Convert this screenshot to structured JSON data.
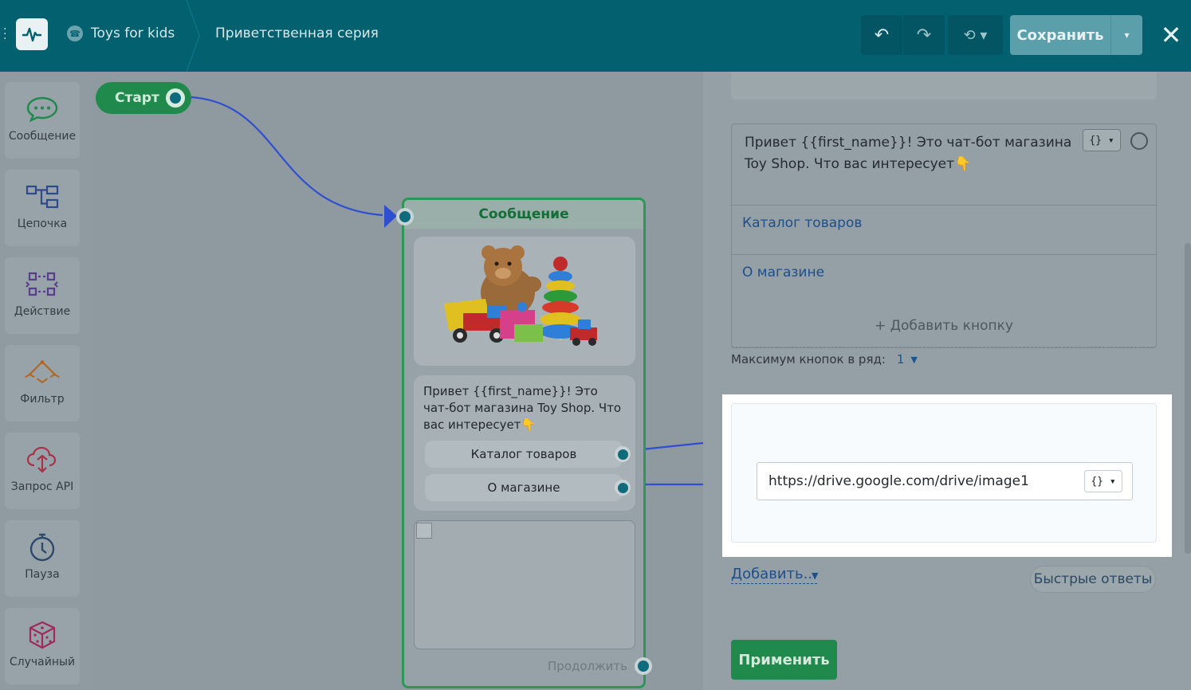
{
  "header": {
    "menu_icon": "⋮",
    "project_name": "Toys for kids",
    "flow_name": "Приветственная серия",
    "undo_icon": "↶",
    "redo_icon": "↷",
    "history_icon": "⟲ ▾",
    "save_label": "Сохранить",
    "save_caret": "▾",
    "close_icon": "✕"
  },
  "tools": [
    {
      "label": "Сообщение",
      "icon": "chat-bubble-icon"
    },
    {
      "label": "Цепочка",
      "icon": "chain-icon"
    },
    {
      "label": "Действие",
      "icon": "action-icon"
    },
    {
      "label": "Фильтр",
      "icon": "filter-icon"
    },
    {
      "label": "Запрос API",
      "icon": "cloud-api-icon"
    },
    {
      "label": "Пауза",
      "icon": "stopwatch-icon"
    },
    {
      "label": "Случайный",
      "icon": "dice-icon"
    }
  ],
  "canvas": {
    "start_label": "Старт",
    "message_node": {
      "title": "Сообщение",
      "text": "Привет {{first_name}}! Это чат-бот магазина Toy Shop. Что вас интересует👇",
      "buttons": [
        "Каталог товаров",
        "О магазине"
      ],
      "continue_label": "Продолжить"
    }
  },
  "panel": {
    "message_text": "Привет {{first_name}}! Это чат-бот магазина Toy Shop. Что вас интересует👇",
    "var_label": "{} ▾",
    "buttons": [
      "Каталог товаров",
      "О магазине"
    ],
    "add_button_label": "+ Добавить кнопку",
    "max_buttons_label": "Максимум кнопок в ряд:",
    "max_buttons_value": "1",
    "image_url": "https://drive.google.com/drive/image1",
    "add_label": "Добавить...",
    "quick_replies_label": "Быстрые ответы",
    "apply_label": "Применить"
  },
  "colors": {
    "topbar": "#03606f",
    "accent_green": "#1f8a4b",
    "link_blue": "#1c4f8c",
    "wire_blue": "#2f4fd0"
  }
}
